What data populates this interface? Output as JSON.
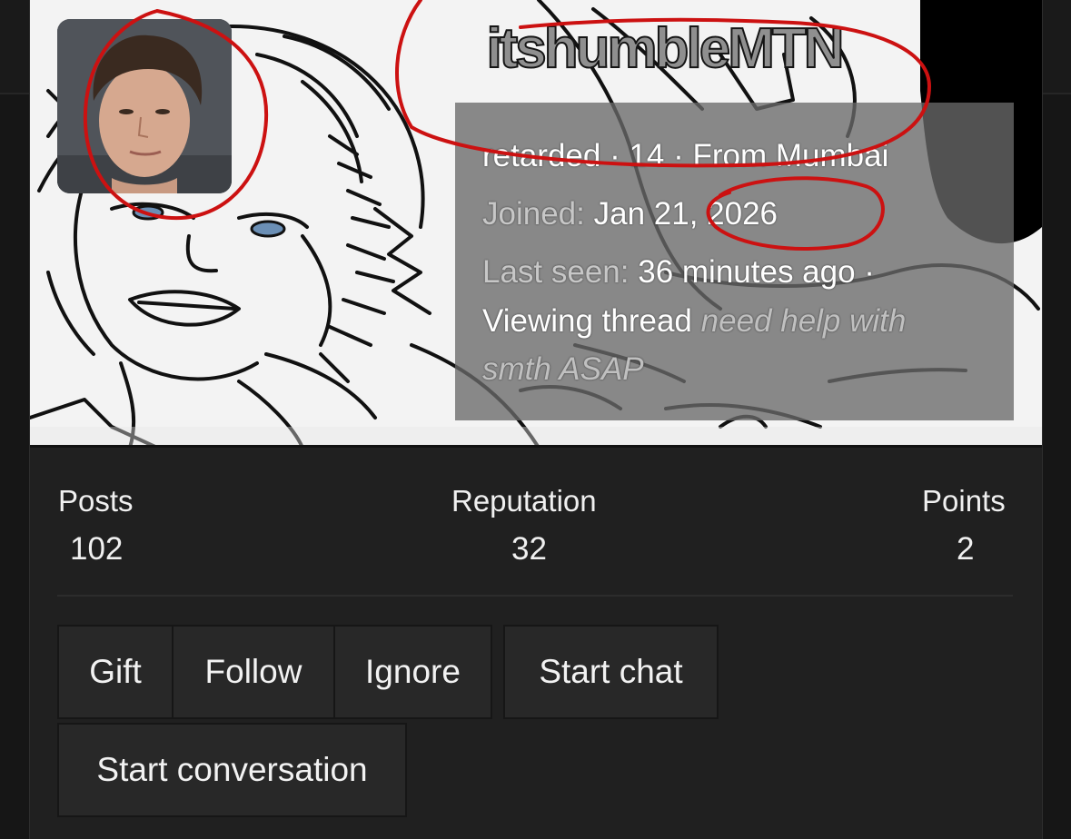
{
  "profile": {
    "username": "itshumbleMTN",
    "bio": {
      "part1": "retarded · 14 · Fro",
      "part2": "m Mumbai"
    },
    "joined": {
      "label": "Joined:",
      "value_a": "Jan 2",
      "value_b": "1",
      "value_c": ", 2026"
    },
    "last_seen": {
      "label": "Last seen:",
      "value": "36 minutes ago ·"
    },
    "viewing": {
      "prefix": "Viewing thread",
      "thread_line1": "need help with",
      "thread_line2": "smth ASAP"
    }
  },
  "stats": [
    {
      "label": "Posts",
      "value": "102"
    },
    {
      "label": "Reputation",
      "value": "32"
    },
    {
      "label": "Points",
      "value": "2"
    }
  ],
  "actions": {
    "gift": "Gift",
    "follow": "Follow",
    "ignore": "Ignore",
    "start_chat": "Start chat",
    "start_conversation": "Start conversation"
  },
  "colors": {
    "annotation_red": "#cc1111",
    "page_bg": "#161616",
    "card_bg": "#202020",
    "button_bg": "#282828"
  }
}
